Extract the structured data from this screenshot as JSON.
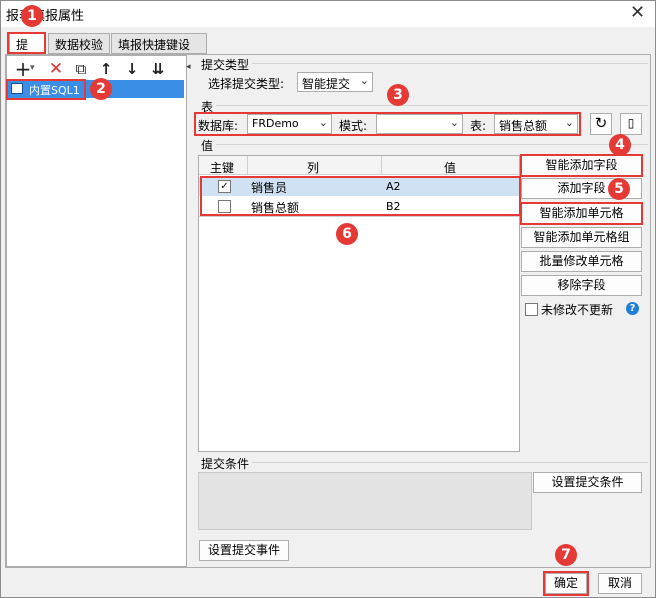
{
  "window": {
    "title": "报表填报属性",
    "close": "✕"
  },
  "tabs": [
    "提交",
    "数据校验",
    "填报快捷键设置"
  ],
  "left": {
    "toolbar": {
      "add": "+",
      "add_menu": "▾",
      "delete": "✕",
      "copy": "⧉",
      "up": "↑",
      "down": "↓",
      "import": "⇊"
    },
    "item": "内置SQL1"
  },
  "submit_type": {
    "section": "提交类型",
    "label": "选择提交类型:",
    "value": "智能提交"
  },
  "table": {
    "section": "表",
    "db_label": "数据库:",
    "db_value": "FRDemo",
    "mode_label": "模式:",
    "mode_value": "",
    "table_label": "表:",
    "table_value": "销售总额"
  },
  "values": {
    "section": "值",
    "headers": [
      "主键",
      "列",
      "值"
    ],
    "rows": [
      {
        "key": true,
        "col": "销售员",
        "val": "A2"
      },
      {
        "key": false,
        "col": "销售总额",
        "val": "B2"
      }
    ]
  },
  "side_buttons": [
    "智能添加字段",
    "添加字段",
    "智能添加单元格",
    "智能添加单元格组",
    "批量修改单元格",
    "移除字段"
  ],
  "no_update": {
    "label": "未修改不更新",
    "help": "?"
  },
  "submit_condition": {
    "section": "提交条件",
    "button": "设置提交条件"
  },
  "submit_event": "设置提交事件",
  "footer": {
    "ok": "确定",
    "cancel": "取消"
  },
  "badges": [
    "1",
    "2",
    "3",
    "4",
    "5",
    "6",
    "7"
  ],
  "colors": {
    "accent_red": "#e53935",
    "selection": "#3a8ee6",
    "help": "#1e7fd8"
  }
}
